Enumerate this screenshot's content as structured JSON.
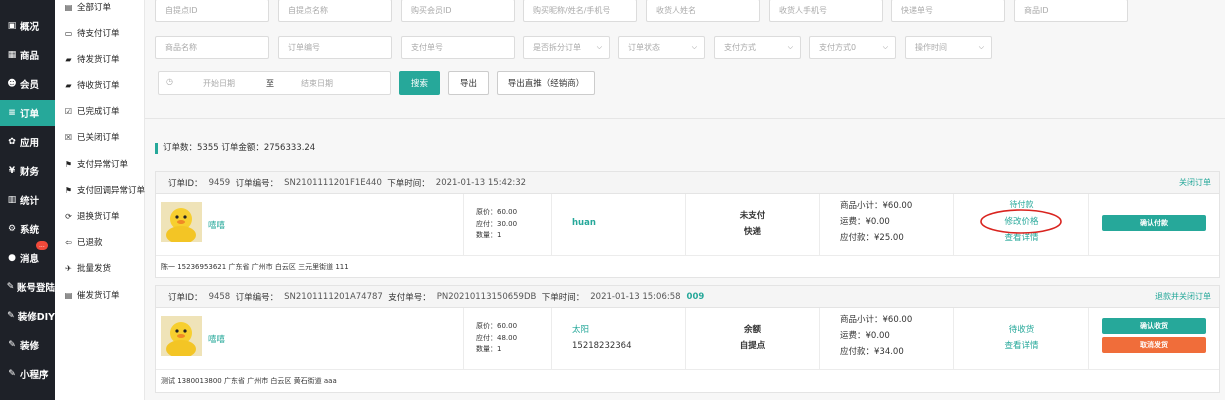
{
  "sidebar": {
    "items": [
      {
        "icon": "▣",
        "label": "概况",
        "icon_name": "dashboard-icon"
      },
      {
        "icon": "▦",
        "label": "商品",
        "icon_name": "goods-icon"
      },
      {
        "icon": "☻",
        "label": "会员",
        "icon_name": "member-icon"
      },
      {
        "icon": "≡",
        "label": "订单",
        "icon_name": "order-icon"
      },
      {
        "icon": "✿",
        "label": "应用",
        "icon_name": "apps-icon"
      },
      {
        "icon": "¥",
        "label": "财务",
        "icon_name": "finance-icon"
      },
      {
        "icon": "▥",
        "label": "统计",
        "icon_name": "stats-icon"
      },
      {
        "icon": "⚙",
        "label": "系统",
        "icon_name": "system-icon"
      },
      {
        "icon": "●",
        "label": "消息",
        "icon_name": "message-icon",
        "badge": "..."
      },
      {
        "icon": "✎",
        "label": "账号登陆",
        "icon_name": "account-icon"
      },
      {
        "icon": "✎",
        "label": "装修DIY",
        "icon_name": "diy-icon"
      },
      {
        "icon": "✎",
        "label": "装修",
        "icon_name": "decorate-icon"
      },
      {
        "icon": "✎",
        "label": "小程序",
        "icon_name": "miniapp-icon"
      }
    ]
  },
  "submenu": {
    "items": [
      {
        "icon": "▤",
        "label": "全部订单"
      },
      {
        "icon": "▭",
        "label": "待支付订单"
      },
      {
        "icon": "▰",
        "label": "待发货订单"
      },
      {
        "icon": "▰",
        "label": "待收货订单"
      },
      {
        "icon": "☑",
        "label": "已完成订单"
      },
      {
        "icon": "☒",
        "label": "已关闭订单"
      },
      {
        "icon": "⚑",
        "label": "支付异常订单"
      },
      {
        "icon": "⚑",
        "label": "支付回调异常订单"
      },
      {
        "icon": "⟳",
        "label": "退换货订单"
      },
      {
        "icon": "⇦",
        "label": "已退款"
      },
      {
        "icon": "✈",
        "label": "批量发货"
      },
      {
        "icon": "▤",
        "label": "催发货订单"
      }
    ]
  },
  "filters": {
    "row1": [
      "自提点ID",
      "自提点名称",
      "购买会员ID",
      "购买昵称/姓名/手机号",
      "收货人姓名",
      "收货人手机号",
      "快递单号",
      "商品ID"
    ],
    "row2_inputs": [
      "商品名称",
      "订单编号",
      "支付单号"
    ],
    "row2_selects": [
      "是否拆分订单",
      "订单状态",
      "支付方式",
      "支付方式0",
      "操作时间"
    ],
    "start_date": "开始日期",
    "to": "至",
    "end_date": "结束日期",
    "search": "搜索",
    "export": "导出",
    "export_direct": "导出直推（经销商）"
  },
  "summary": "订单数：5355    订单金额：2756333.24",
  "orders": [
    {
      "id_label": "订单ID：",
      "id": "9459",
      "no_label": "订单编号：",
      "no": "SN2101111201F1E440",
      "pay_label": "",
      "pay_no": "",
      "time_label": "下单时间：",
      "time": "2021-01-13 15:42:32",
      "tag": "",
      "link": "关闭订单",
      "product": "嘻嘻",
      "price_lines": [
        "原价：60.00",
        "应付：30.00",
        "数量：1"
      ],
      "buyer_name": "huan",
      "buyer_phone": "",
      "status": "未支付",
      "method": "快递",
      "subtotal": "商品小计：¥60.00",
      "freight": "运费：¥0.00",
      "payable": "应付款：¥25.00",
      "state_text": "待付款",
      "modify_price": "修改价格",
      "details": "查看详情",
      "actions": [
        {
          "label": "确认付款",
          "color": "#26a89a"
        }
      ],
      "address": "陈一   15236953621   广东省 广州市 白云区 三元里街道 111"
    },
    {
      "id_label": "订单ID：",
      "id": "9458",
      "no_label": "订单编号：",
      "no": "SN2101111201A74787",
      "pay_label": "支付单号：",
      "pay_no": "PN20210113150659DB",
      "time_label": "下单时间：",
      "time": "2021-01-13 15:06:58",
      "tag": "009",
      "link": "退款并关闭订单",
      "product": "嘻嘻",
      "price_lines": [
        "原价：60.00",
        "应付：48.00",
        "数量：1"
      ],
      "buyer_name": "太阳",
      "buyer_phone": "15218232364",
      "status": "余额",
      "method": "自提点",
      "subtotal": "商品小计：¥60.00",
      "freight": "运费：¥0.00",
      "payable": "应付款：¥34.00",
      "state_text": "待收货",
      "modify_price": "",
      "details": "查看详情",
      "actions": [
        {
          "label": "确认收货",
          "color": "#26a89a"
        },
        {
          "label": "取消发货",
          "color": "#f06d3a"
        }
      ],
      "address": "测试   1380013800   广东省 广州市 白云区 黄石街道 aaa"
    }
  ],
  "colors": {
    "accent": "#26a89a",
    "sidebar_bg": "#1e2128",
    "danger": "#f06d3a",
    "annotation": "#d9241f"
  }
}
